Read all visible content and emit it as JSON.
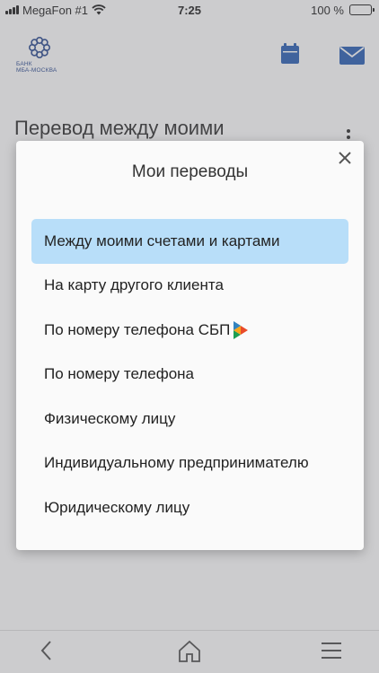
{
  "status_bar": {
    "carrier": "MegaFon #1",
    "time": "7:25",
    "battery": "100 %"
  },
  "header": {
    "logo_line1": "БАНК",
    "logo_line2": "МБА-МОСКВА",
    "icons": [
      "calendar-icon",
      "mail-icon"
    ]
  },
  "page": {
    "title": "Перевод между моими"
  },
  "modal": {
    "title": "Мои переводы",
    "items": [
      {
        "label": "Между моими счетами и картами",
        "selected": true
      },
      {
        "label": "На карту другого клиента"
      },
      {
        "label": "По номеру телефона СБП",
        "icon": "sbp-logo-icon"
      },
      {
        "label": "По номеру телефона"
      },
      {
        "label": "Физическому лицу"
      },
      {
        "label": "Индивидуальному предпринимателю"
      },
      {
        "label": "Юридическому лицу"
      }
    ]
  },
  "tab_bar": {
    "icons": [
      "back-chevron-icon",
      "home-icon",
      "hamburger-menu-icon"
    ]
  },
  "colors": {
    "brand_blue": "#1e56b0",
    "selected_bg": "#b8def9",
    "overlay": "rgba(120,120,125,0.38)"
  }
}
